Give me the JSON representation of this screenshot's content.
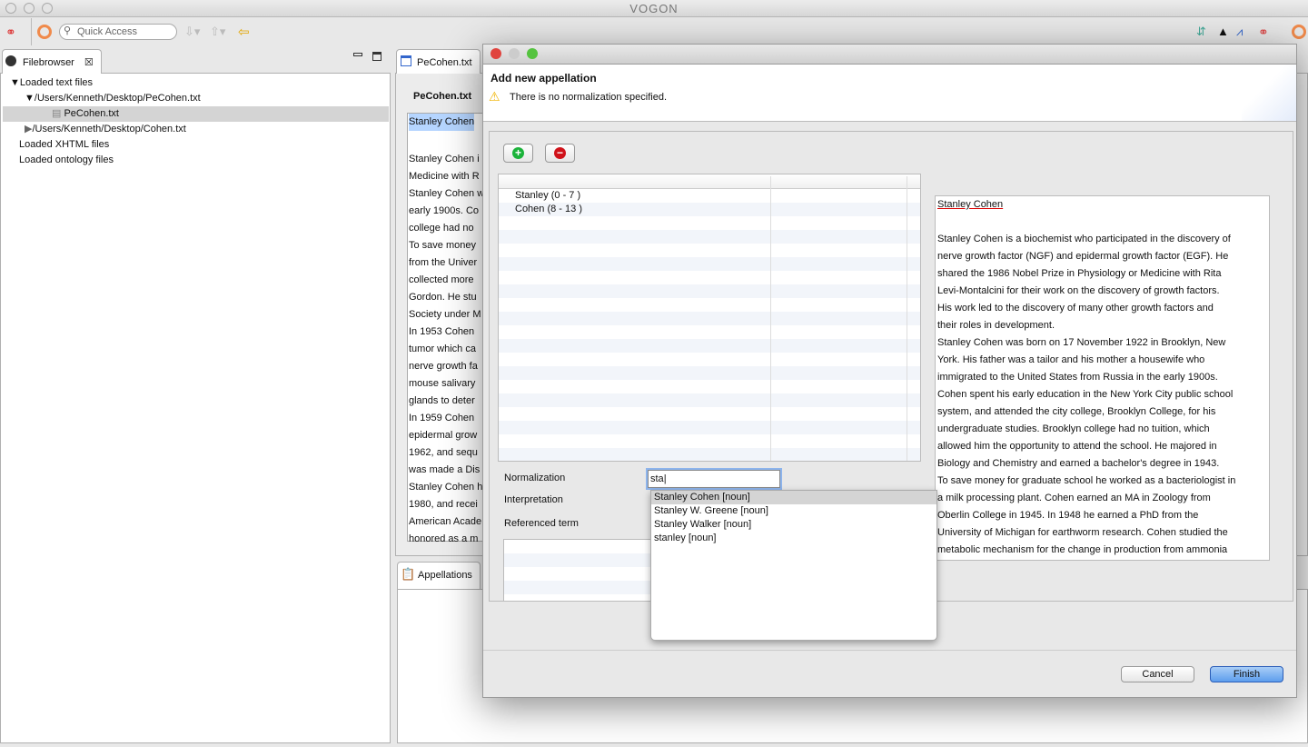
{
  "app": {
    "title": "VOGON",
    "quick_access_placeholder": "Quick Access"
  },
  "filebrowser": {
    "tab": "Filebrowser",
    "tree": [
      {
        "label": "Loaded text files",
        "level": 0,
        "expanded": true
      },
      {
        "label": "/Users/Kenneth/Desktop/PeCohen.txt",
        "level": 1,
        "expanded": true
      },
      {
        "label": "PeCohen.txt",
        "level": 2,
        "selected": true
      },
      {
        "label": "/Users/Kenneth/Desktop/Cohen.txt",
        "level": 1,
        "expanded": false
      },
      {
        "label": "Loaded XHTML files",
        "level": 0
      },
      {
        "label": "Loaded ontology files",
        "level": 0
      }
    ]
  },
  "editor": {
    "tab": "PeCohen.txt",
    "heading": "PeCohen.txt",
    "lines": [
      "Stanley Cohen",
      "",
      "Stanley Cohen i",
      "Medicine with R",
      "Stanley Cohen w",
      "early 1900s.  Co",
      "college had no",
      "To save money",
      "from the Univer",
      "collected more",
      "Gordon.  He stu",
      "Society under M",
      "In 1953 Cohen",
      "tumor which ca",
      "nerve growth fa",
      "mouse salivary",
      "glands to deter",
      "In 1959 Cohen",
      "epidermal grow",
      "1962, and sequ",
      "was made a Dis",
      "Stanley Cohen h",
      "1980, and recei",
      "American Acade",
      "honored as a m"
    ]
  },
  "appellations": {
    "tab": "Appellations"
  },
  "dialog": {
    "title": "Add new appellation",
    "message": "There is no normalization specified.",
    "terms": [
      "Stanley (0 - 7 )",
      "Cohen (8 - 13 )"
    ],
    "labels": {
      "normalization": "Normalization",
      "interpretation": "Interpretation",
      "referenced": "Referenced term"
    },
    "normalization_value": "sta",
    "suggestions": [
      "Stanley Cohen [noun]",
      "Stanley W. Greene [noun]",
      "Stanley Walker [noun]",
      "stanley [noun]"
    ],
    "preview": [
      "Stanley Cohen",
      "",
      "Stanley Cohen is a biochemist who participated in the discovery of",
      "nerve growth factor (NGF) and epidermal growth factor (EGF).  He",
      "shared the 1986 Nobel Prize in Physiology or Medicine with Rita",
      "Levi-Montalcini for their work on the discovery of growth factors.",
      "His work led to the discovery of many other growth factors and",
      "their roles in development.",
      "Stanley Cohen was born on 17 November 1922 in Brooklyn, New",
      "York.  His father was a tailor and his mother a housewife who",
      "immigrated to the United States from Russia in the early 1900s.",
      "Cohen spent his early education in the New York City public school",
      "system, and attended the city college, Brooklyn College, for his",
      "undergraduate studies.  Brooklyn college had no tuition, which",
      "allowed him the opportunity to attend the school.   He majored in",
      "Biology and Chemistry and earned a bachelor's degree in 1943.",
      "To save money for graduate school he worked as a bacteriologist in",
      "a milk processing plant.  Cohen earned an MA in Zoology from",
      "Oberlin College in 1945.  In 1948 he earned a PhD from the",
      "University of Michigan for earthworm research.  Cohen studied the",
      "metabolic mechanism for the change in production from ammonia"
    ],
    "cancel": "Cancel",
    "finish": "Finish"
  },
  "colors": {
    "accent": "#3b82e0",
    "selection": "#b5d5ff",
    "warning": "#f0b400"
  }
}
